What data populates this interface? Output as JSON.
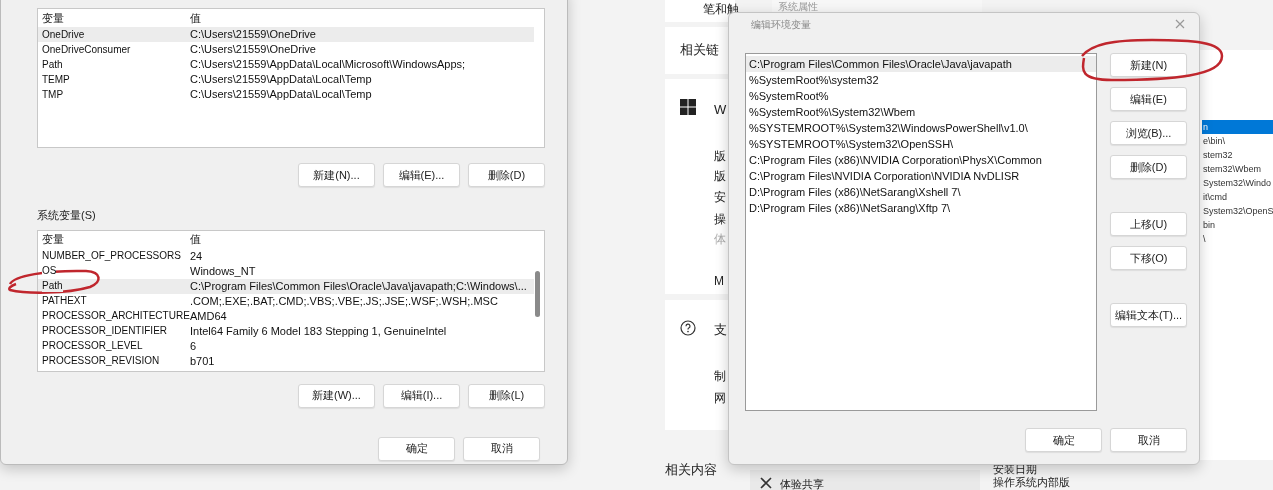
{
  "user_vars": {
    "columns": [
      "变量",
      "值"
    ],
    "rows": [
      {
        "name": "OneDrive",
        "value": "C:\\Users\\21559\\OneDrive",
        "selected": true
      },
      {
        "name": "OneDriveConsumer",
        "value": "C:\\Users\\21559\\OneDrive",
        "selected": false
      },
      {
        "name": "Path",
        "value": "C:\\Users\\21559\\AppData\\Local\\Microsoft\\WindowsApps;",
        "selected": false
      },
      {
        "name": "TEMP",
        "value": "C:\\Users\\21559\\AppData\\Local\\Temp",
        "selected": false
      },
      {
        "name": "TMP",
        "value": "C:\\Users\\21559\\AppData\\Local\\Temp",
        "selected": false
      }
    ],
    "buttons": [
      "新建(N)...",
      "编辑(E)...",
      "删除(D)"
    ]
  },
  "system_vars": {
    "label": "系统变量(S)",
    "columns": [
      "变量",
      "值"
    ],
    "rows": [
      {
        "name": "NUMBER_OF_PROCESSORS",
        "value": "24",
        "selected": false
      },
      {
        "name": "OS",
        "value": "Windows_NT",
        "selected": false
      },
      {
        "name": "Path",
        "value": "C:\\Program Files\\Common Files\\Oracle\\Java\\javapath;C:\\Windows\\...",
        "selected": true
      },
      {
        "name": "PATHEXT",
        "value": ".COM;.EXE;.BAT;.CMD;.VBS;.VBE;.JS;.JSE;.WSF;.WSH;.MSC",
        "selected": false
      },
      {
        "name": "PROCESSOR_ARCHITECTURE",
        "value": "AMD64",
        "selected": false
      },
      {
        "name": "PROCESSOR_IDENTIFIER",
        "value": "Intel64 Family 6 Model 183 Stepping 1, GenuineIntel",
        "selected": false
      },
      {
        "name": "PROCESSOR_LEVEL",
        "value": "6",
        "selected": false
      },
      {
        "name": "PROCESSOR_REVISION",
        "value": "b701",
        "selected": false
      }
    ],
    "buttons": [
      "新建(W)...",
      "编辑(I)...",
      "删除(L)"
    ]
  },
  "dialog_buttons": [
    "确定",
    "取消"
  ],
  "settings_page": {
    "fragments": [
      "笔和触",
      "相关链",
      "W",
      "版",
      "版",
      "安",
      "操",
      "体",
      "M",
      "支",
      "制",
      "网",
      "相关内容",
      "体验共享",
      "安装日期",
      "操作系统内部版"
    ]
  },
  "edit_dialog": {
    "title": "编辑环境变量",
    "entries": [
      {
        "text": "C:\\Program Files\\Common Files\\Oracle\\Java\\javapath",
        "selected": true
      },
      {
        "text": "%SystemRoot%\\system32",
        "selected": false
      },
      {
        "text": "%SystemRoot%",
        "selected": false
      },
      {
        "text": "%SystemRoot%\\System32\\Wbem",
        "selected": false
      },
      {
        "text": "%SYSTEMROOT%\\System32\\WindowsPowerShell\\v1.0\\",
        "selected": false
      },
      {
        "text": "%SYSTEMROOT%\\System32\\OpenSSH\\",
        "selected": false
      },
      {
        "text": "C:\\Program Files (x86)\\NVIDIA Corporation\\PhysX\\Common",
        "selected": false
      },
      {
        "text": "C:\\Program Files\\NVIDIA Corporation\\NVIDIA NvDLISR",
        "selected": false
      },
      {
        "text": "D:\\Program Files (x86)\\NetSarang\\Xshell 7\\",
        "selected": false
      },
      {
        "text": "D:\\Program Files (x86)\\NetSarang\\Xftp 7\\",
        "selected": false
      }
    ],
    "side_buttons": [
      [
        "新建(N)",
        "编辑(E)",
        "浏览(B)...",
        "删除(D)"
      ],
      [
        "上移(U)",
        "下移(O)"
      ],
      [
        "编辑文本(T)..."
      ]
    ],
    "buttons": [
      "确定",
      "取消"
    ]
  },
  "behind_window": {
    "title": "系统属性",
    "entries": [
      {
        "text": "n",
        "selected": true
      },
      {
        "text": "e\\bin\\",
        "selected": false
      },
      {
        "text": "stem32",
        "selected": false
      },
      {
        "text": "stem32\\Wbem",
        "selected": false
      },
      {
        "text": "System32\\Windo",
        "selected": false
      },
      {
        "text": "it\\cmd",
        "selected": false
      },
      {
        "text": "System32\\OpenS",
        "selected": false
      },
      {
        "text": "bin",
        "selected": false
      },
      {
        "text": "\\",
        "selected": false
      }
    ]
  }
}
